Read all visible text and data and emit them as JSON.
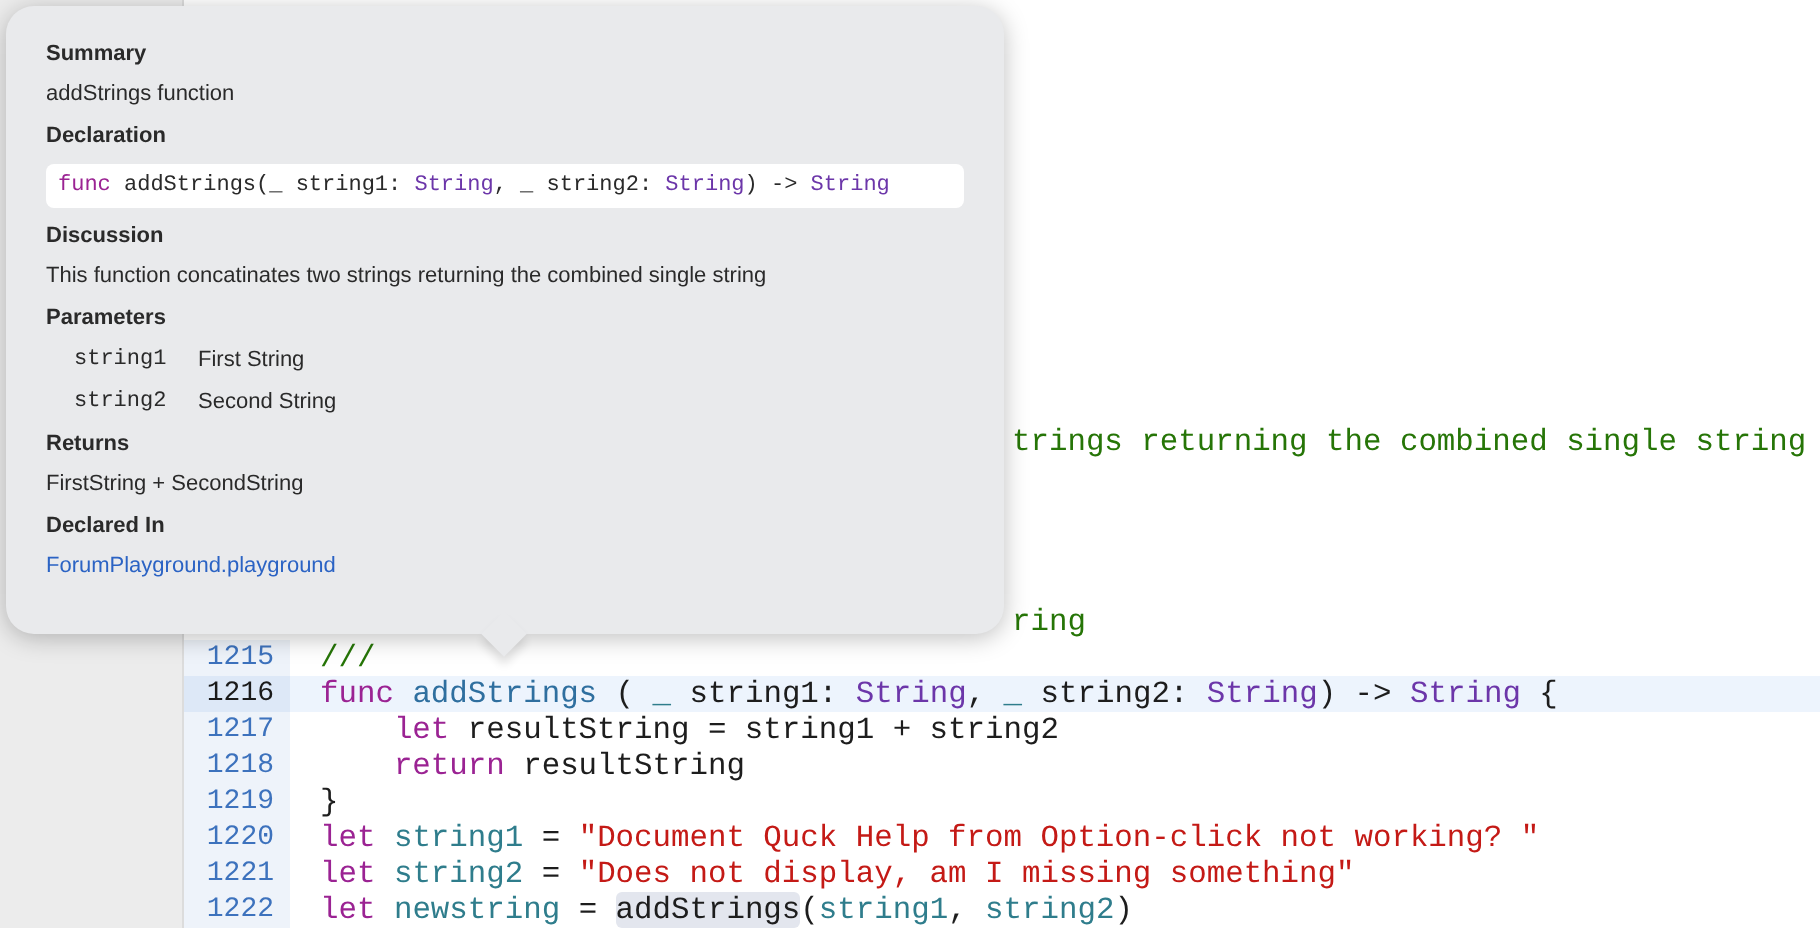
{
  "editor": {
    "lines": [
      {
        "kind": "fragment",
        "tokens": [
          {
            "text": "trings returning the combined single string",
            "kind": "comment"
          }
        ]
      },
      {
        "kind": "blank"
      },
      {
        "kind": "blank"
      },
      {
        "kind": "blank"
      },
      {
        "kind": "blank"
      },
      {
        "kind": "fragment",
        "tokens": [
          {
            "text": "ring",
            "kind": "comment"
          }
        ]
      },
      {
        "kind": "code",
        "number": "1215",
        "current": false,
        "tokens": [
          {
            "text": "///",
            "kind": "comment"
          }
        ]
      },
      {
        "kind": "code",
        "number": "1216",
        "current": true,
        "tokens": [
          {
            "text": "func",
            "kind": "keyword"
          },
          {
            "text": " addStrings",
            "kind": "fn"
          },
          {
            "text": " ( ",
            "kind": "plain"
          },
          {
            "text": "_",
            "kind": "var"
          },
          {
            "text": " string1: ",
            "kind": "plain"
          },
          {
            "text": "String",
            "kind": "type"
          },
          {
            "text": ", ",
            "kind": "plain"
          },
          {
            "text": "_",
            "kind": "var"
          },
          {
            "text": " string2: ",
            "kind": "plain"
          },
          {
            "text": "String",
            "kind": "type"
          },
          {
            "text": ") -> ",
            "kind": "plain"
          },
          {
            "text": "String",
            "kind": "type"
          },
          {
            "text": " {",
            "kind": "plain"
          }
        ]
      },
      {
        "kind": "code",
        "number": "1217",
        "current": false,
        "tokens": [
          {
            "text": "    let",
            "kind": "keyword"
          },
          {
            "text": " resultString = string1 + string2",
            "kind": "plain"
          }
        ]
      },
      {
        "kind": "code",
        "number": "1218",
        "current": false,
        "tokens": [
          {
            "text": "    return",
            "kind": "keyword"
          },
          {
            "text": " resultString",
            "kind": "plain"
          }
        ]
      },
      {
        "kind": "code",
        "number": "1219",
        "current": false,
        "tokens": [
          {
            "text": "}",
            "kind": "plain"
          }
        ]
      },
      {
        "kind": "code",
        "number": "1220",
        "current": false,
        "tokens": [
          {
            "text": "let",
            "kind": "keyword"
          },
          {
            "text": " string1",
            "kind": "var"
          },
          {
            "text": " = ",
            "kind": "plain"
          },
          {
            "text": "\"Document Quck Help from Option-click not working? \"",
            "kind": "string"
          }
        ]
      },
      {
        "kind": "code",
        "number": "1221",
        "current": false,
        "tokens": [
          {
            "text": "let",
            "kind": "keyword"
          },
          {
            "text": " string2",
            "kind": "var"
          },
          {
            "text": " = ",
            "kind": "plain"
          },
          {
            "text": "\"Does not display, am I missing something\"",
            "kind": "string"
          }
        ]
      },
      {
        "kind": "code",
        "number": "1222",
        "current": false,
        "tokens": [
          {
            "text": "let",
            "kind": "keyword"
          },
          {
            "text": " newstring",
            "kind": "var"
          },
          {
            "text": " = ",
            "kind": "plain"
          },
          {
            "text": "addStrings",
            "kind": "match"
          },
          {
            "text": "(",
            "kind": "plain"
          },
          {
            "text": "string1",
            "kind": "var"
          },
          {
            "text": ", ",
            "kind": "plain"
          },
          {
            "text": "string2",
            "kind": "var"
          },
          {
            "text": ")",
            "kind": "plain"
          }
        ]
      }
    ]
  },
  "quick_help": {
    "sections": [
      {
        "kind": "text",
        "heading": "Summary",
        "text": "addStrings function"
      },
      {
        "kind": "code",
        "heading": "Declaration",
        "tokens": [
          {
            "text": "func",
            "kind": "keyword"
          },
          {
            "text": " addStrings(_ string1: ",
            "kind": "plain"
          },
          {
            "text": "String",
            "kind": "type"
          },
          {
            "text": ", _ string2: ",
            "kind": "plain"
          },
          {
            "text": "String",
            "kind": "type"
          },
          {
            "text": ") -> ",
            "kind": "plain"
          },
          {
            "text": "String",
            "kind": "type"
          }
        ]
      },
      {
        "kind": "text",
        "heading": "Discussion",
        "text": "This function concatinates two strings returning the combined single string"
      },
      {
        "kind": "params",
        "heading": "Parameters",
        "params": [
          {
            "name": "string1",
            "description": "First String"
          },
          {
            "name": "string2",
            "description": "Second String"
          }
        ]
      },
      {
        "kind": "text",
        "heading": "Returns",
        "text": "FirstString + SecondString"
      },
      {
        "kind": "link",
        "heading": "Declared In",
        "text": "ForumPlayground.playground"
      }
    ]
  }
}
